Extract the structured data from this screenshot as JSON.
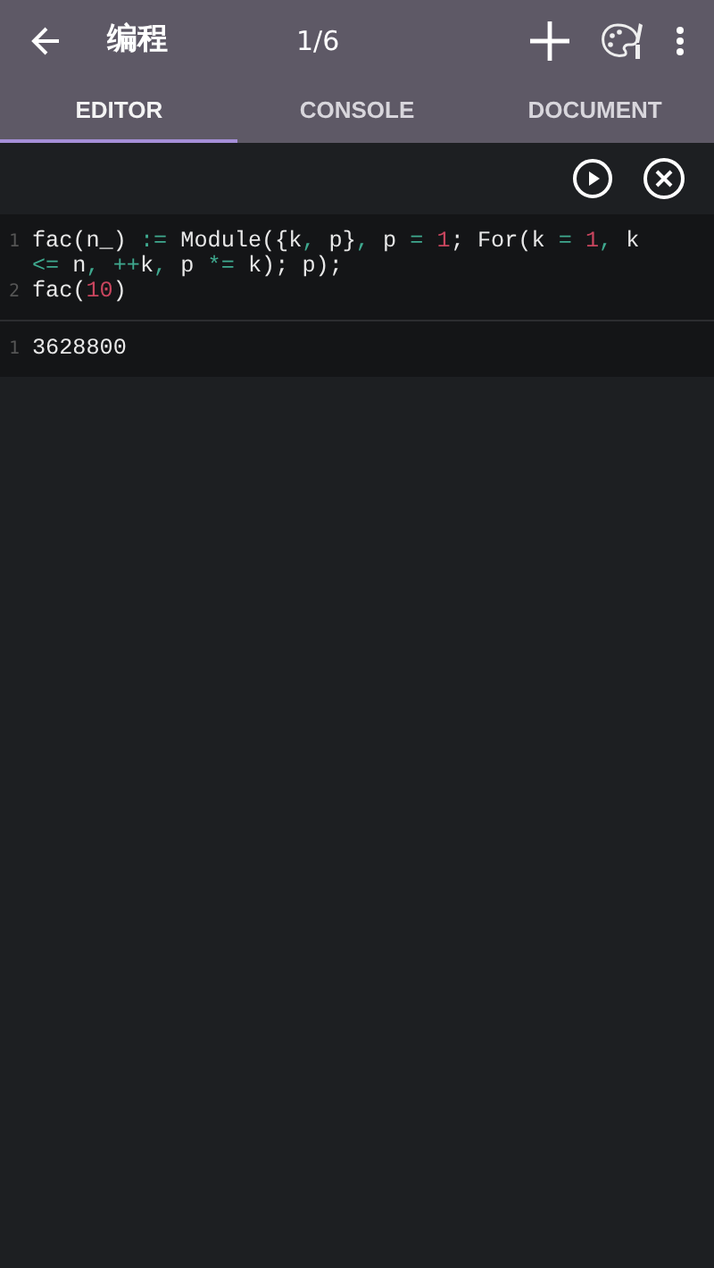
{
  "app_bar": {
    "title": "编程",
    "page_counter": "1/6"
  },
  "tabs": [
    {
      "label": "EDITOR",
      "selected": true
    },
    {
      "label": "CONSOLE",
      "selected": false
    },
    {
      "label": "DOCUMENT",
      "selected": false
    }
  ],
  "input_cell": {
    "lines": [
      {
        "number": "1",
        "tokens": [
          {
            "kind": "plain",
            "text": "fac(n_) "
          },
          {
            "kind": "op",
            "text": ":="
          },
          {
            "kind": "plain",
            "text": " Module({k"
          },
          {
            "kind": "op",
            "text": ","
          },
          {
            "kind": "plain",
            "text": " p}"
          },
          {
            "kind": "op",
            "text": ","
          },
          {
            "kind": "plain",
            "text": " p "
          },
          {
            "kind": "op",
            "text": "= "
          },
          {
            "kind": "num",
            "text": "1"
          },
          {
            "kind": "plain",
            "text": "; For(k "
          },
          {
            "kind": "op",
            "text": "= "
          },
          {
            "kind": "num",
            "text": "1"
          },
          {
            "kind": "op",
            "text": ","
          },
          {
            "kind": "plain",
            "text": " k "
          },
          {
            "kind": "op",
            "text": "<="
          },
          {
            "kind": "plain",
            "text": " n"
          },
          {
            "kind": "op",
            "text": ", ++"
          },
          {
            "kind": "plain",
            "text": "k"
          },
          {
            "kind": "op",
            "text": ","
          },
          {
            "kind": "plain",
            "text": " p "
          },
          {
            "kind": "op",
            "text": "*="
          },
          {
            "kind": "plain",
            "text": " k); p);"
          }
        ]
      },
      {
        "number": "2",
        "tokens": [
          {
            "kind": "plain",
            "text": "fac("
          },
          {
            "kind": "num",
            "text": "10"
          },
          {
            "kind": "plain",
            "text": ")"
          }
        ]
      }
    ]
  },
  "output_cell": {
    "lines": [
      {
        "number": "1",
        "text": "3628800"
      }
    ]
  }
}
